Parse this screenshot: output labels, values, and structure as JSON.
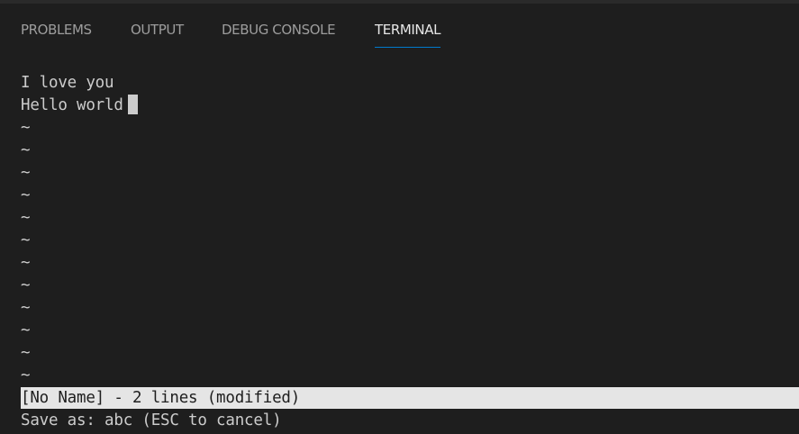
{
  "tabs": {
    "problems": "PROBLEMS",
    "output": "OUTPUT",
    "debug_console": "DEBUG CONSOLE",
    "terminal": "TERMINAL",
    "active": "TERMINAL"
  },
  "editor": {
    "lines": [
      "I love you",
      "Hello world"
    ],
    "empty_marker": "~",
    "empty_count": 12
  },
  "status": {
    "info": "[No Name] - 2 lines (modified)"
  },
  "prompt": {
    "text": "Save as: abc (ESC to cancel)"
  },
  "colors": {
    "background": "#1e1e1e",
    "accent": "#007acc",
    "text": "#cccccc",
    "status_bg": "#e5e5e5"
  }
}
